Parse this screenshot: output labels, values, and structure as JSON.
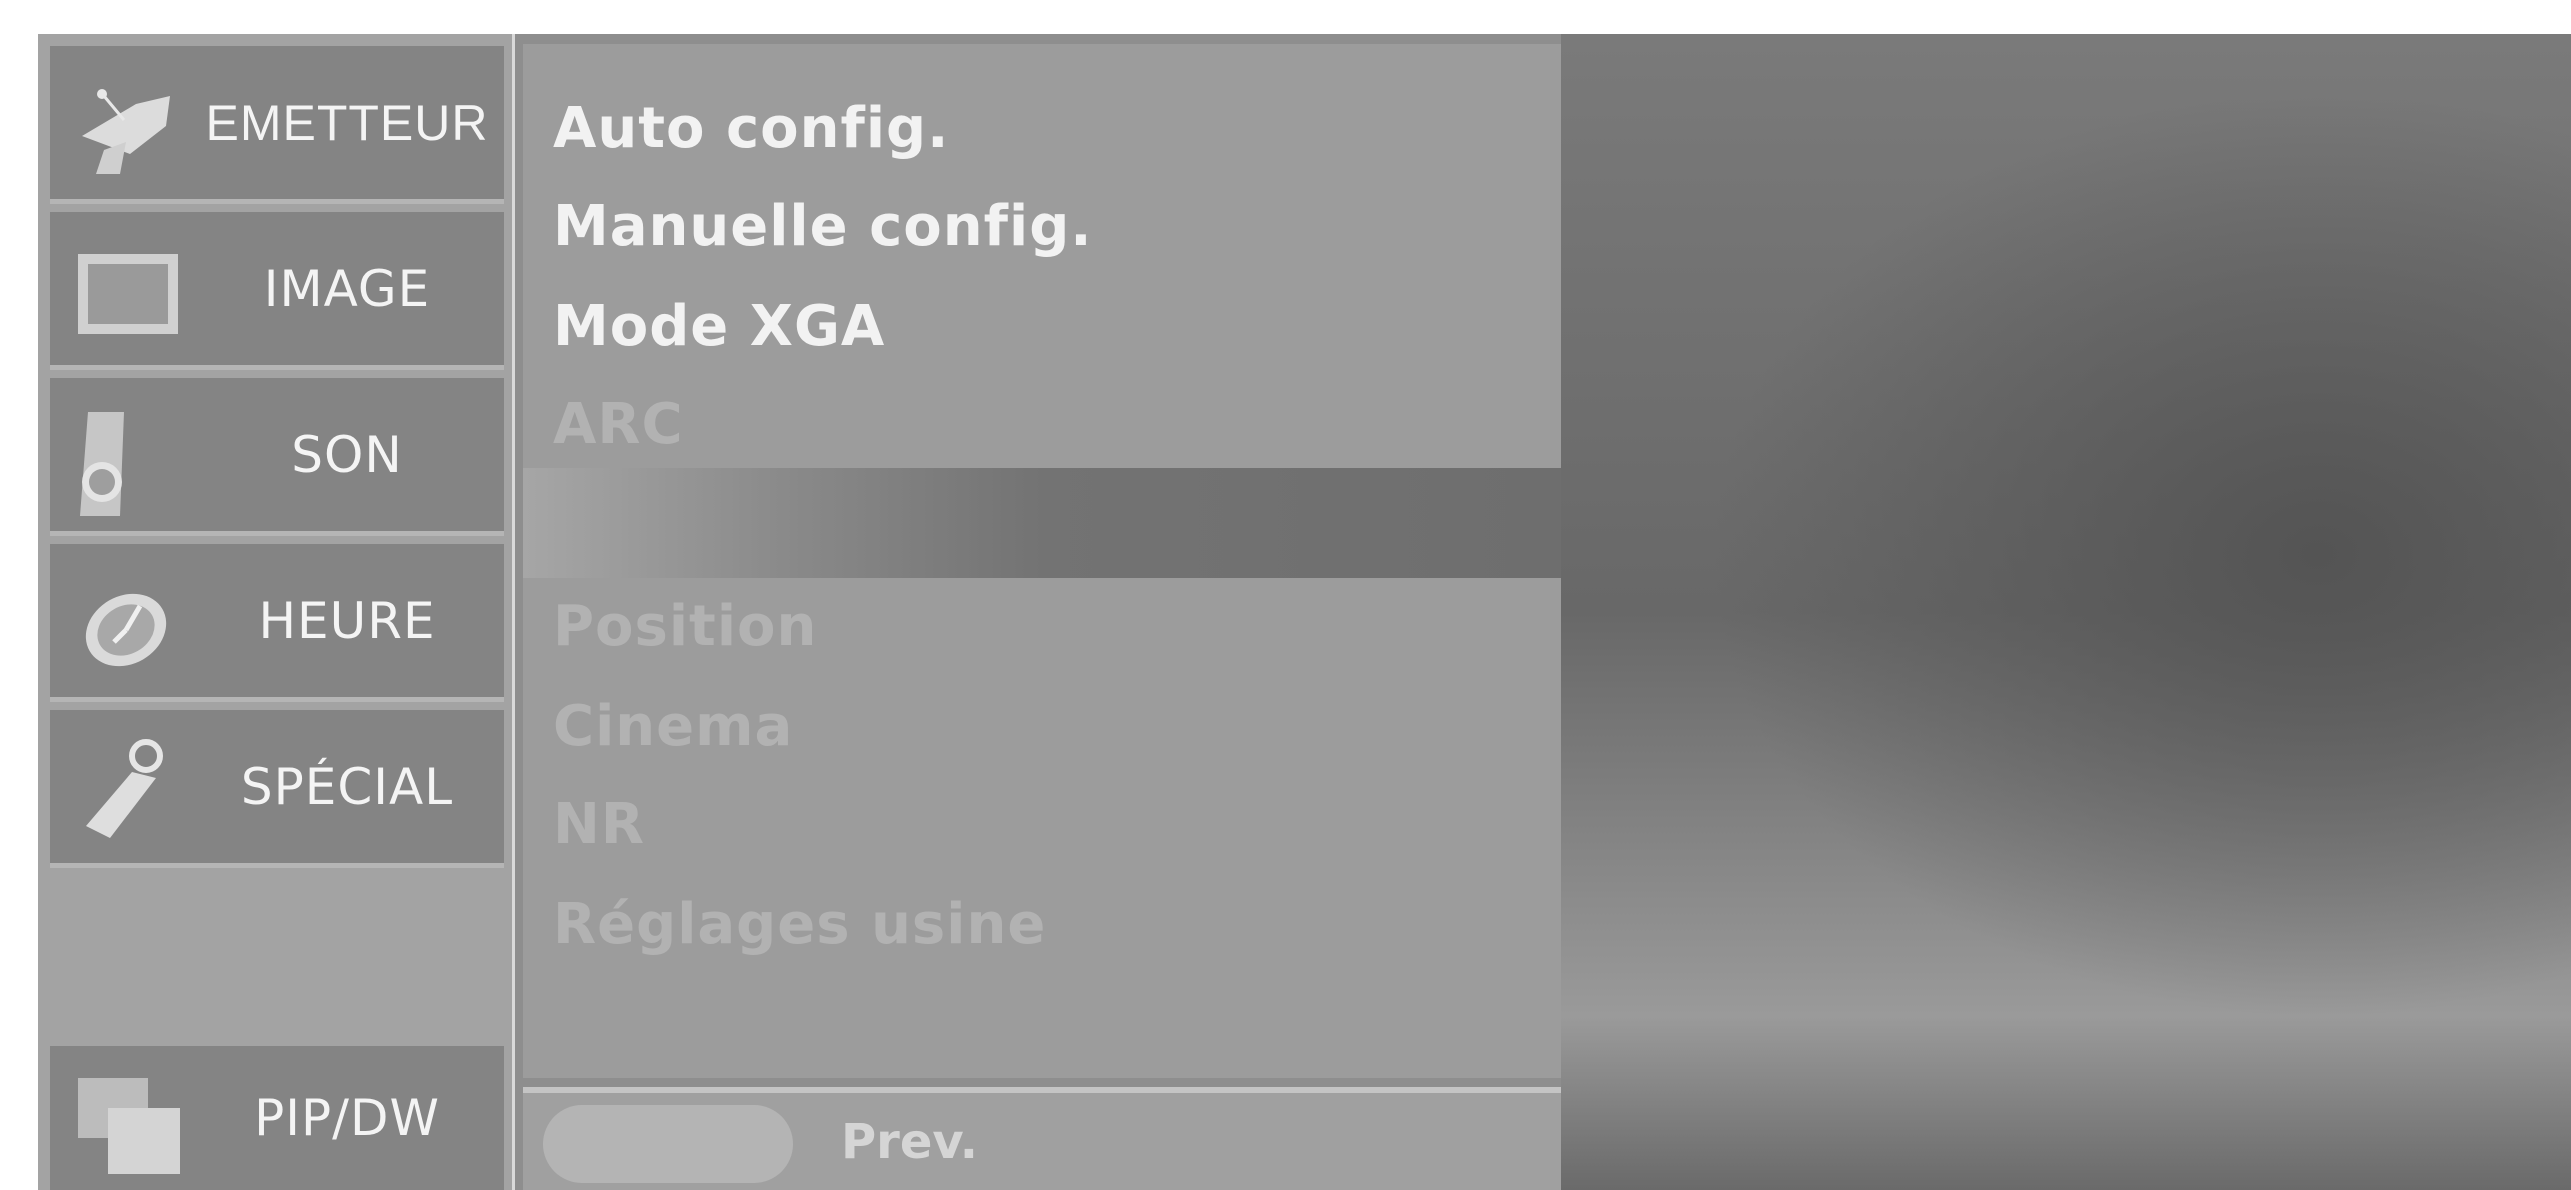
{
  "sidebar": {
    "items": [
      {
        "label": "EMETTEUR",
        "icon": "satellite-dish-icon"
      },
      {
        "label": "IMAGE",
        "icon": "picture-icon"
      },
      {
        "label": "SON",
        "icon": "speaker-icon"
      },
      {
        "label": "HEURE",
        "icon": "clock-icon"
      },
      {
        "label": "SPÉCIAL",
        "icon": "key-tag-icon"
      }
    ],
    "pip": {
      "label": "PIP/DW",
      "icon": "pip-windows-icon"
    }
  },
  "submenu": {
    "items": [
      {
        "label": "Auto config.",
        "state": "enabled"
      },
      {
        "label": "Manuelle config.",
        "state": "enabled"
      },
      {
        "label": "Mode XGA",
        "state": "enabled"
      },
      {
        "label": "ARC",
        "state": "dimmed"
      },
      {
        "label": "",
        "state": "highlighted"
      },
      {
        "label": "Position",
        "state": "dimmed"
      },
      {
        "label": "Cinema",
        "state": "dimmed"
      },
      {
        "label": "NR",
        "state": "dimmed"
      },
      {
        "label": "Réglages usine",
        "state": "dimmed"
      }
    ]
  },
  "footer": {
    "prev_label": "Prev."
  },
  "colors": {
    "menu_background": "#9c9c9c",
    "category_background": "#848484",
    "enabled_text": "#f2f2f2",
    "dimmed_text": "#b2b2b2"
  }
}
